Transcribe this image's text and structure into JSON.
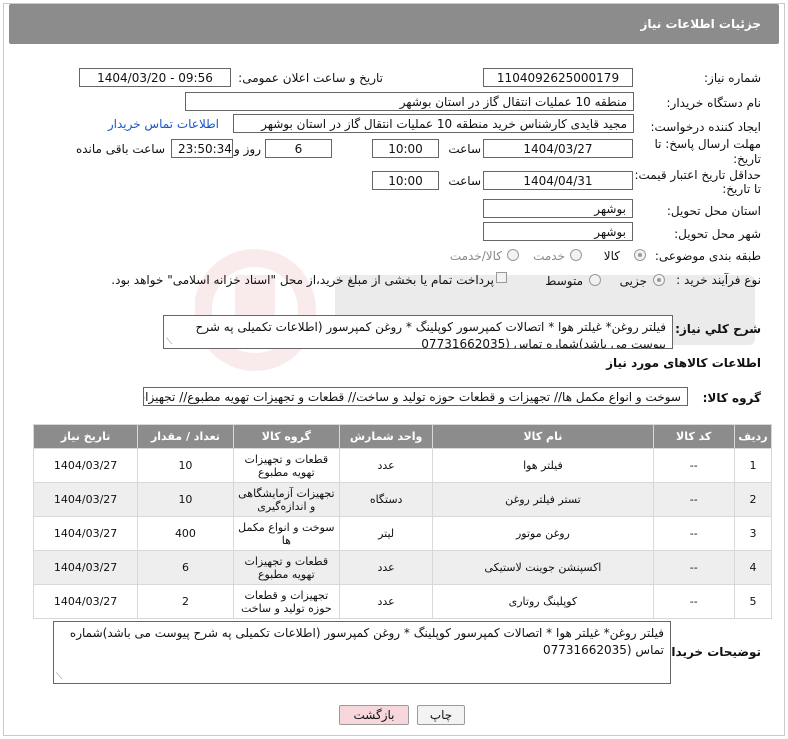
{
  "header": {
    "title": "جزئیات اطلاعات نیاز"
  },
  "form": {
    "need_number_label": "شماره نیاز:",
    "need_number": "1104092625000179",
    "announce_label": "تاریخ و ساعت اعلان عمومی:",
    "announce_value": "1404/03/20 - 09:56",
    "buyer_org_label": "نام دستگاه خریدار:",
    "buyer_org": "منطقه 10 عملیات انتقال گاز در استان بوشهر",
    "creator_label": "ایجاد کننده درخواست:",
    "creator": "مجید قایدی کارشناس خرید منطقه 10 عملیات انتقال گاز در استان بوشهر",
    "contact_link": "اطلاعات تماس خریدار",
    "deadline_label_1": "مهلت ارسال پاسخ: تا",
    "deadline_label_2": "تاریخ:",
    "deadline_date": "1404/03/27",
    "time_label": "ساعت",
    "deadline_time": "10:00",
    "days_value": "6",
    "days_label": "روز و",
    "remaining_time": "23:50:34",
    "remaining_label": "ساعت باقی مانده",
    "min_price_label_1": "حداقل تاریخ اعتبار قیمت:",
    "min_price_label_2": "تا تاریخ:",
    "min_price_date": "1404/04/31",
    "min_price_time": "10:00",
    "province_label": "استان محل تحویل:",
    "province": "بوشهر",
    "city_label": "شهر محل تحویل:",
    "city": "بوشهر",
    "category_label": "طبقه بندی موضوعی:",
    "category_options": [
      "کالا",
      "خدمت",
      "کالا/خدمت"
    ],
    "category_selected": "کالا",
    "process_label": "نوع فرآیند خرید :",
    "process_options": [
      "جزیی",
      "متوسط"
    ],
    "process_note": "پرداخت تمام یا بخشی از مبلغ خرید،از محل \"اسناد خزانه اسلامی\" خواهد بود."
  },
  "description": {
    "label": "شرح کلي نياز:",
    "text": "فیلتر روغن* غیلتر هوا * اتصالات کمپرسور  کوپلینگ * روغن کمپرسور (اطلاعات تکمیلی په شرح پیوست می باشد)شماره تماس (07731662035"
  },
  "goods_section": {
    "title": "اطلاعات کالاهای مورد نیاز",
    "group_label": "گروه کالا:",
    "group_value": "سوخت و انواع مکمل ها// تجهیزات و قطعات حوزه تولید و ساخت//  قطعات و تجهیزات تهویه مطبوع// تجهیزات آ"
  },
  "table": {
    "headers": [
      "ردیف",
      "کد کالا",
      "نام کالا",
      "واحد شمارش",
      "گروه کالا",
      "تعداد / مقدار",
      "تاریخ نیاز"
    ],
    "rows": [
      {
        "idx": "1",
        "code": "--",
        "name": "فیلتر هوا",
        "unit": "عدد",
        "group": "قطعات و تجهیزات تهویه مطبوع",
        "qty": "10",
        "date": "1404/03/27"
      },
      {
        "idx": "2",
        "code": "--",
        "name": "تستر فیلتر روغن",
        "unit": "دستگاه",
        "group": "تجهیزات آزمایشگاهی و اندازه‌گیری",
        "qty": "10",
        "date": "1404/03/27"
      },
      {
        "idx": "3",
        "code": "--",
        "name": "روغن موتور",
        "unit": "لیتر",
        "group": "سوخت و انواع مکمل ها",
        "qty": "400",
        "date": "1404/03/27"
      },
      {
        "idx": "4",
        "code": "--",
        "name": "اکسپنشن جوینت لاستیکی",
        "unit": "عدد",
        "group": "قطعات و تجهیزات تهویه مطبوع",
        "qty": "6",
        "date": "1404/03/27"
      },
      {
        "idx": "5",
        "code": "--",
        "name": "کوپلینگ روتاری",
        "unit": "عدد",
        "group": "تجهیزات و قطعات حوزه تولید و ساخت",
        "qty": "2",
        "date": "1404/03/27"
      }
    ]
  },
  "buyer_notes": {
    "label": "توضیحات خریدار:",
    "text": "فیلتر روغن* غیلتر هوا * اتصالات کمپرسور  کوپلینگ * روغن کمپرسور (اطلاعات تکمیلی په شرح پیوست می باشد)شماره تماس (07731662035"
  },
  "buttons": {
    "print": "چاپ",
    "back": "بازگشت"
  },
  "colors": {
    "header_bg": "#8c8c8c",
    "link": "#1a55c9",
    "back_btn_bg": "#f7d7dc"
  }
}
